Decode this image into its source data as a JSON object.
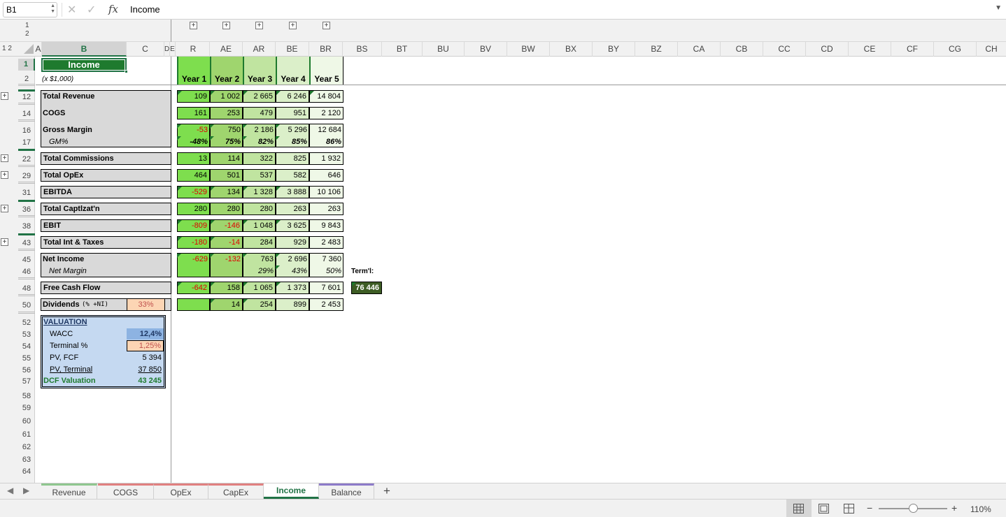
{
  "formula_bar": {
    "name_box": "B1",
    "formula": "Income",
    "fx": "fx"
  },
  "outline_levels": [
    "1",
    "2"
  ],
  "column_headers": [
    "A",
    "B",
    "C",
    "D",
    "E",
    "R",
    "AE",
    "AR",
    "BE",
    "BR",
    "BS",
    "BT",
    "BU",
    "BV",
    "BW",
    "BX",
    "BY",
    "BZ",
    "CA",
    "CB",
    "CC",
    "CD",
    "CE",
    "CF",
    "CG",
    "CH"
  ],
  "row_headers": [
    "1",
    "2",
    "12",
    "14",
    "16",
    "17",
    "22",
    "29",
    "31",
    "36",
    "38",
    "43",
    "45",
    "46",
    "48",
    "50",
    "52",
    "53",
    "54",
    "55",
    "56",
    "57",
    "58",
    "59",
    "60",
    "61",
    "62",
    "63",
    "64"
  ],
  "sheet": {
    "title": "Income",
    "units": "(x $1,000)",
    "years": [
      "Year 1",
      "Year 2",
      "Year 3",
      "Year 4",
      "Year 5"
    ],
    "rows": [
      {
        "label": "Total Revenue",
        "values": [
          "109",
          "1 002",
          "2 665",
          "6 246",
          "14 804"
        ]
      },
      {
        "label": "COGS",
        "values": [
          "161",
          "253",
          "479",
          "951",
          "2 120"
        ]
      },
      {
        "label": "Gross Margin",
        "values": [
          "-53",
          "750",
          "2 186",
          "5 296",
          "12 684"
        ]
      },
      {
        "label": "GM%",
        "values": [
          "-48%",
          "75%",
          "82%",
          "85%",
          "86%"
        ]
      },
      {
        "label": "Total Commissions",
        "values": [
          "13",
          "114",
          "322",
          "825",
          "1 932"
        ]
      },
      {
        "label": "Total OpEx",
        "values": [
          "464",
          "501",
          "537",
          "582",
          "646"
        ]
      },
      {
        "label": "EBITDA",
        "values": [
          "-529",
          "134",
          "1 328",
          "3 888",
          "10 106"
        ]
      },
      {
        "label": "Total Captlzat'n",
        "values": [
          "280",
          "280",
          "280",
          "263",
          "263"
        ]
      },
      {
        "label": "EBIT",
        "values": [
          "-809",
          "-146",
          "1 048",
          "3 625",
          "9 843"
        ]
      },
      {
        "label": "Total Int & Taxes",
        "values": [
          "-180",
          "-14",
          "284",
          "929",
          "2 483"
        ]
      },
      {
        "label": "Net Income",
        "values": [
          "-629",
          "-132",
          "763",
          "2 696",
          "7 360"
        ]
      },
      {
        "label": "Net Margin",
        "values": [
          "",
          "",
          "29%",
          "43%",
          "50%"
        ]
      },
      {
        "label": "Free Cash Flow",
        "values": [
          "-642",
          "158",
          "1 065",
          "1 373",
          "7 601"
        ]
      },
      {
        "label": "Dividends",
        "label_suffix": "(% +NI)",
        "extra": "33%",
        "values": [
          "",
          "14",
          "254",
          "899",
          "2 453"
        ]
      }
    ],
    "terminal_label": "Term'l:",
    "terminal_value": "76 446",
    "valuation": {
      "title": "VALUATION",
      "items": [
        {
          "label": "WACC",
          "value": "12,4%"
        },
        {
          "label": "Terminal %",
          "value": "1,25%"
        },
        {
          "label": "PV, FCF",
          "value": "5 394"
        },
        {
          "label": "PV, Terminal",
          "value": "37 850"
        },
        {
          "label": "DCF Valuation",
          "value": "43 245"
        }
      ]
    }
  },
  "tabs": [
    "Revenue",
    "COGS",
    "OpEx",
    "CapEx",
    "Income",
    "Balance"
  ],
  "active_tab": "Income",
  "tab_colors": [
    "#8fc78f",
    "#e08080",
    "#e08080",
    "#e08080",
    "#217346",
    "#8c7ac8"
  ],
  "add_sheet": "+",
  "status": {
    "zoom": "110%"
  },
  "colors": {
    "accent": "#217346",
    "title_bg": "#1e7a2e",
    "terminal_bg": "#3d5c24",
    "valuation_bg": "#c5d9f1",
    "input_orange": "#fcd5b4",
    "wacc_blue": "#8db3e2"
  }
}
